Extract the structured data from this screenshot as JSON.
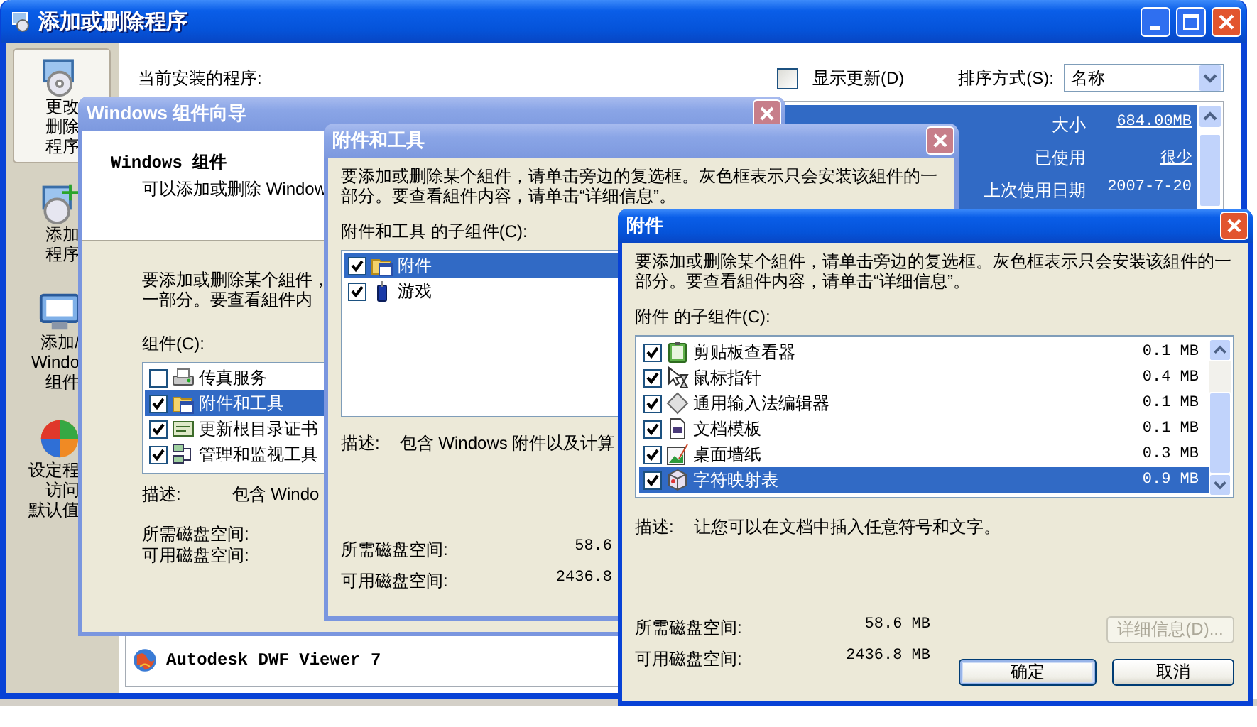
{
  "main_window": {
    "title": "添加或删除程序",
    "active": true,
    "sidebar": [
      {
        "kind": "change",
        "lines": [
          "更改",
          "删除",
          "程序"
        ],
        "selected": true
      },
      {
        "kind": "add",
        "lines": [
          "添加",
          "程序"
        ],
        "selected": false
      },
      {
        "kind": "windows",
        "lines": [
          "添加/",
          "Windo",
          "组件"
        ],
        "selected": false
      },
      {
        "kind": "defaults",
        "lines": [
          "设定程",
          "访问",
          "默认值"
        ],
        "selected": false
      }
    ],
    "list_label": "当前安装的程序:",
    "show_updates": {
      "label": "显示更新(D)",
      "checked": false
    },
    "sort": {
      "label": "排序方式(S):",
      "value": "名称"
    },
    "selected_program": {
      "details": [
        {
          "label": "大小",
          "value": "684.00MB",
          "kind": "link"
        },
        {
          "label": "已使用",
          "value": "很少",
          "kind": "link"
        },
        {
          "label": "上次使用日期",
          "value": "2007-7-20",
          "kind": "text"
        }
      ]
    },
    "programs": [
      {
        "kind": "globe",
        "name": "Autodesk DWF Viewer 7"
      }
    ]
  },
  "wizard": {
    "title": "Windows 组件向导",
    "active": false,
    "heading": "Windows 组件",
    "subheading": "可以添加或删除 Window",
    "intro": [
      "要添加或删除某个組件，",
      "一部分。要查看組件内"
    ],
    "list_label": "组件(C):",
    "components": [
      {
        "kind": "fax",
        "name": "传真服务",
        "checked": false,
        "selected": false
      },
      {
        "kind": "folder",
        "name": "附件和工具",
        "checked": true,
        "selected": true
      },
      {
        "kind": "certificate",
        "name": "更新根目录证书",
        "checked": true,
        "selected": false
      },
      {
        "kind": "network",
        "name": "管理和监视工具",
        "checked": true,
        "selected": false
      }
    ],
    "description_label": "描述:",
    "description": "包含 Windo",
    "space_labels": [
      "所需磁盘空间:",
      "可用磁盘空间:"
    ]
  },
  "accessories_tools": {
    "title": "附件和工具",
    "active": false,
    "intro": [
      "要添加或删除某个組件，请单击旁边的复选框。灰色框表示只会安装该組件的一",
      "部分。要查看組件内容，请单击“详细信息”。"
    ],
    "list_label": "附件和工具 的子组件(C):",
    "components": [
      {
        "kind": "folder",
        "name": "附件",
        "checked": true,
        "selected": true
      },
      {
        "kind": "joystick",
        "name": "游戏",
        "checked": true,
        "selected": false
      }
    ],
    "description_label": "描述:",
    "description": "包含 Windows 附件以及计算",
    "space": [
      {
        "label": "所需磁盘空间:",
        "value": "58.6"
      },
      {
        "label": "可用磁盘空间:",
        "value": "2436.8"
      }
    ]
  },
  "accessories": {
    "title": "附件",
    "active": true,
    "intro": [
      "要添加或删除某个組件，请单击旁边的复选框。灰色框表示只会安装该組件的一",
      "部分。要查看組件内容，请单击“详细信息”。"
    ],
    "list_label": "附件 的子组件(C):",
    "components": [
      {
        "kind": "clipboard",
        "name": "剪贴板查看器",
        "size": "0.1 MB",
        "checked": true,
        "selected": false
      },
      {
        "kind": "cursor",
        "name": "鼠标指针",
        "size": "0.4 MB",
        "checked": true,
        "selected": false
      },
      {
        "kind": "diamond",
        "name": "通用输入法编辑器",
        "size": "0.1 MB",
        "checked": true,
        "selected": false
      },
      {
        "kind": "document",
        "name": "文档模板",
        "size": "0.1 MB",
        "checked": true,
        "selected": false
      },
      {
        "kind": "wallpaper",
        "name": "桌面墙纸",
        "size": "0.3 MB",
        "checked": true,
        "selected": false
      },
      {
        "kind": "charmap",
        "name": "字符映射表",
        "size": "0.9 MB",
        "checked": true,
        "selected": true
      }
    ],
    "description_label": "描述:",
    "description": "让您可以在文档中插入任意符号和文字。",
    "space": [
      {
        "label": "所需磁盘空间:",
        "value": "58.6 MB"
      },
      {
        "label": "可用磁盘空间:",
        "value": "2436.8 MB"
      }
    ],
    "buttons": [
      {
        "label": "详细信息(D)...",
        "disabled": true,
        "default": false
      },
      {
        "label": "确定",
        "disabled": false,
        "default": true
      },
      {
        "label": "取消",
        "disabled": false,
        "default": false
      }
    ]
  }
}
